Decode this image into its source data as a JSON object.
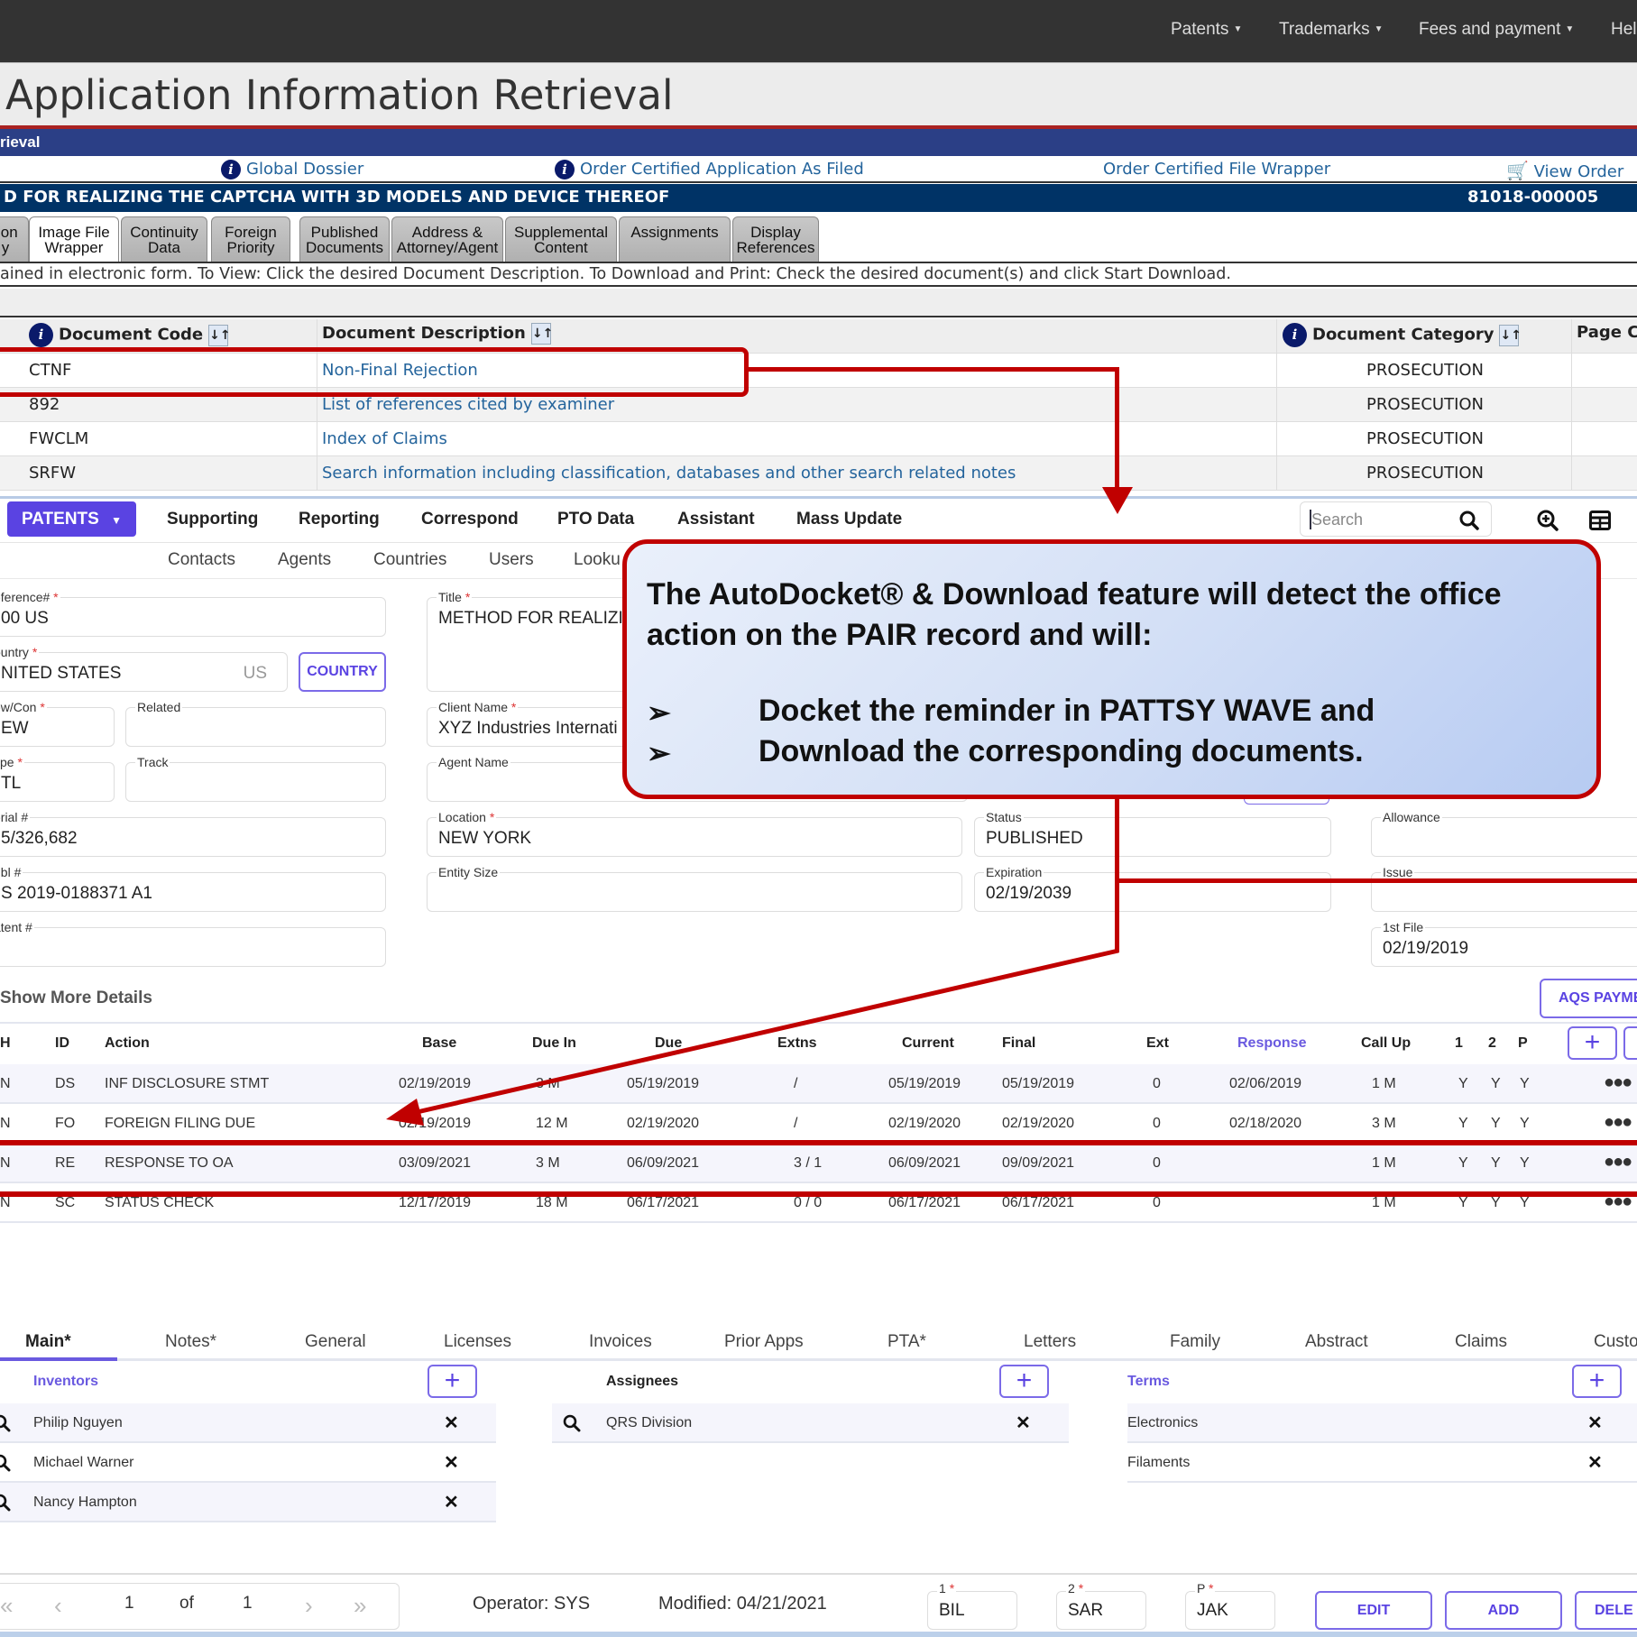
{
  "top_nav": {
    "items": [
      "Patents",
      "Trademarks",
      "Fees and payment",
      "Hel"
    ]
  },
  "page_title": "Application Information Retrieval",
  "blue_bar_label": "rieval",
  "links": {
    "global_dossier": "Global Dossier",
    "order_certified_app": "Order Certified Application As Filed",
    "order_certified_wrapper": "Order Certified File Wrapper",
    "view_order": "View Order"
  },
  "application": {
    "title": "D FOR REALIZING THE CAPTCHA WITH 3D MODELS AND DEVICE THEREOF",
    "number": "81018-000005"
  },
  "pair_tabs": [
    {
      "label": "tion\ny",
      "active": false
    },
    {
      "label": "Image File\nWrapper",
      "active": true
    },
    {
      "label": "Continuity\nData",
      "active": false
    },
    {
      "label": "Foreign\nPriority",
      "active": false
    },
    {
      "label": "Published\nDocuments",
      "active": false
    },
    {
      "label": "Address &\nAttorney/Agent",
      "active": false
    },
    {
      "label": "Supplemental\nContent",
      "active": false
    },
    {
      "label": "Assignments",
      "active": false
    },
    {
      "label": "Display\nReferences",
      "active": false
    }
  ],
  "info_line": "ained in electronic form. To View: Click the desired Document Description. To Download and Print: Check the desired document(s) and click Start Download.",
  "documents": {
    "headers": {
      "code": "Document Code",
      "description": "Document Description",
      "category": "Document Category",
      "page": "Page C"
    },
    "rows": [
      {
        "code": "CTNF",
        "description": "Non-Final Rejection",
        "category": "PROSECUTION"
      },
      {
        "code": "892",
        "description": "List of references cited by examiner",
        "category": "PROSECUTION"
      },
      {
        "code": "FWCLM",
        "description": "Index of Claims",
        "category": "PROSECUTION"
      },
      {
        "code": "SRFW",
        "description": "Search information including classification, databases and other search related notes",
        "category": "PROSECUTION"
      }
    ]
  },
  "patsy": {
    "main_button": "PATENTS",
    "menu": [
      "Supporting",
      "Reporting",
      "Correspond",
      "PTO Data",
      "Assistant",
      "Mass Update"
    ],
    "search_placeholder": "Search",
    "submenu": [
      "Contacts",
      "Agents",
      "Countries",
      "Users",
      "Looku"
    ]
  },
  "fields": {
    "reference": {
      "label": "eference#",
      "value": "00 US",
      "required": "*"
    },
    "country": {
      "label": "ountry",
      "value": "NITED STATES",
      "code": "US",
      "required": "*"
    },
    "country_button": "COUNTRY",
    "newcon": {
      "label": "ew/Con",
      "value": "EW",
      "required": "*"
    },
    "related": {
      "label": "Related",
      "value": ""
    },
    "type": {
      "label": "ype",
      "value": "TL",
      "required": "*"
    },
    "track": {
      "label": "Track",
      "value": ""
    },
    "serial": {
      "label": "erial #",
      "value": "5/326,682"
    },
    "publ": {
      "label": "ubl #",
      "value": "S 2019-0188371 A1"
    },
    "patent": {
      "label": "atent #",
      "value": ""
    },
    "title": {
      "label": "Title",
      "value": "METHOD FOR REALIZIN",
      "required": "*"
    },
    "client": {
      "label": "Client Name",
      "value": "XYZ Industries Internati",
      "required": "*"
    },
    "agent": {
      "label": "Agent Name",
      "value": ""
    },
    "location": {
      "label": "Location",
      "value": "NEW YORK",
      "required": "*"
    },
    "entity": {
      "label": "Entity Size",
      "value": ""
    },
    "status": {
      "label": "Status",
      "value": "PUBLISHED"
    },
    "expiration": {
      "label": "Expiration",
      "value": "02/19/2039"
    },
    "allowance": {
      "label": "Allowance",
      "value": ""
    },
    "issue": {
      "label": "Issue",
      "value": ""
    },
    "first_file": {
      "label": "1st File",
      "value": "02/19/2019"
    },
    "show_more": "Show More Details",
    "aqs_button": "AQS PAYME"
  },
  "callout": {
    "intro": "The AutoDocket® & Download feature will detect the office action on the PAIR record and will:",
    "bullets": [
      "Docket the reminder in PATTSY WAVE and",
      "Download the corresponding documents."
    ],
    "bullet_glyph": "➢"
  },
  "actions": {
    "headers": [
      "H",
      "ID",
      "Action",
      "Base",
      "Due In",
      "Due",
      "Extns",
      "Current",
      "Final",
      "Ext",
      "Response",
      "Call Up",
      "1",
      "2",
      "P"
    ],
    "rows": [
      {
        "h": "N",
        "id": "DS",
        "action": "INF DISCLOSURE STMT",
        "base": "02/19/2019",
        "due_in": "3 M",
        "due": "05/19/2019",
        "extns": "/",
        "current": "05/19/2019",
        "final": "05/19/2019",
        "ext": "0",
        "response": "02/06/2019",
        "call_up": "1 M",
        "c1": "Y",
        "c2": "Y",
        "p": "Y"
      },
      {
        "h": "N",
        "id": "FO",
        "action": "FOREIGN FILING DUE",
        "base": "02/19/2019",
        "due_in": "12 M",
        "due": "02/19/2020",
        "extns": "/",
        "current": "02/19/2020",
        "final": "02/19/2020",
        "ext": "0",
        "response": "02/18/2020",
        "call_up": "3 M",
        "c1": "Y",
        "c2": "Y",
        "p": "Y"
      },
      {
        "h": "N",
        "id": "RE",
        "action": "RESPONSE TO OA",
        "base": "03/09/2021",
        "due_in": "3 M",
        "due": "06/09/2021",
        "extns": "3 / 1",
        "current": "06/09/2021",
        "final": "09/09/2021",
        "ext": "0",
        "response": "",
        "call_up": "1 M",
        "c1": "Y",
        "c2": "Y",
        "p": "Y"
      },
      {
        "h": "N",
        "id": "SC",
        "action": "STATUS CHECK",
        "base": "12/17/2019",
        "due_in": "18 M",
        "due": "06/17/2021",
        "extns": "0 / 0",
        "current": "06/17/2021",
        "final": "06/17/2021",
        "ext": "0",
        "response": "",
        "call_up": "1 M",
        "c1": "Y",
        "c2": "Y",
        "p": "Y"
      }
    ],
    "more_glyph": "●●●"
  },
  "bottom_tabs": [
    "Main*",
    "Notes*",
    "General",
    "Licenses",
    "Invoices",
    "Prior Apps",
    "PTA*",
    "Letters",
    "Family",
    "Abstract",
    "Claims",
    "Custo"
  ],
  "inventors": {
    "title": "Inventors",
    "items": [
      "Philip Nguyen",
      "Michael Warner",
      "Nancy Hampton"
    ]
  },
  "assignees": {
    "title": "Assignees",
    "items": [
      "QRS Division"
    ]
  },
  "terms": {
    "title": "Terms",
    "items": [
      "Electronics",
      "Filaments"
    ]
  },
  "footer": {
    "page_current": "1",
    "of_label": "of",
    "page_total": "1",
    "operator": "Operator: SYS",
    "modified": "Modified: 04/21/2021",
    "f1": {
      "label": "1",
      "value": "BIL"
    },
    "f2": {
      "label": "2",
      "value": "SAR"
    },
    "fp": {
      "label": "P",
      "value": "JAK"
    },
    "edit": "EDIT",
    "add": "ADD",
    "delete": "DELE"
  },
  "colors": {
    "accent": "#5a43e2",
    "annotation_red": "#c00000",
    "pair_navy": "#003366",
    "link_blue": "#24649c"
  }
}
